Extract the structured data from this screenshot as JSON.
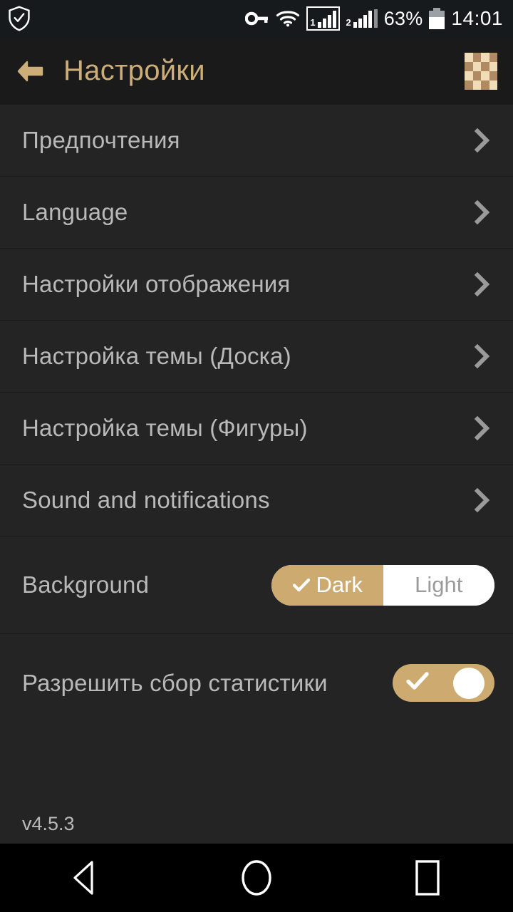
{
  "statusbar": {
    "shield_icon": "shield-check-icon",
    "vpn_key_icon": "vpn-key-icon",
    "wifi_icon": "wifi-icon",
    "sim1_label": "1",
    "sim2_label": "2",
    "battery_percent": "63%",
    "time": "14:01"
  },
  "appbar": {
    "back_icon": "back-arrow-icon",
    "title": "Настройки",
    "board_icon": "chessboard-icon"
  },
  "colors": {
    "accent": "#cdab70",
    "title": "#cdae79",
    "row_bg": "#242424",
    "header_bg": "#1a1a1a",
    "status_bg": "#171a1c",
    "label": "#b9b9b9",
    "chevron": "#9a9a9a",
    "seg_inactive_text": "#9b9b9b"
  },
  "settings": {
    "rows": [
      {
        "label": "Предпочтения",
        "type": "nav",
        "name": "preferences"
      },
      {
        "label": "Language",
        "type": "nav",
        "name": "language"
      },
      {
        "label": "Настройки отображения",
        "type": "nav",
        "name": "display-settings"
      },
      {
        "label": "Настройка темы (Доска)",
        "type": "nav",
        "name": "theme-board"
      },
      {
        "label": "Настройка темы (Фигуры)",
        "type": "nav",
        "name": "theme-pieces"
      },
      {
        "label": "Sound and notifications",
        "type": "nav",
        "name": "sound-and-notifications"
      }
    ],
    "background": {
      "label": "Background",
      "options": [
        "Dark",
        "Light"
      ],
      "selected": "Dark"
    },
    "statistics": {
      "label": "Разрешить сбор статистики",
      "enabled": true
    },
    "version": "v4.5.3"
  },
  "navbar": {
    "back": "back-triangle-icon",
    "home": "home-circle-icon",
    "recents": "recents-square-icon"
  }
}
